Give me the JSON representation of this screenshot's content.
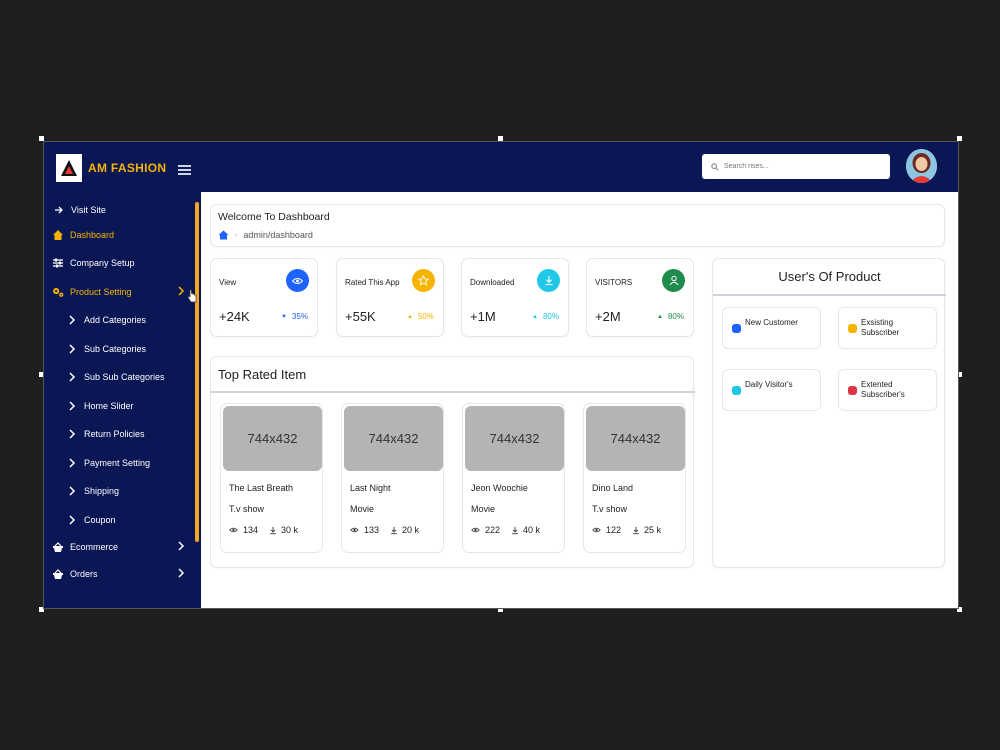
{
  "header": {
    "brand": "AM FASHION",
    "search_placeholder": "Search rises..."
  },
  "sidebar": {
    "items": [
      {
        "label": "Visit Site",
        "icon": "arrow-right-icon"
      },
      {
        "label": "Dashboard",
        "icon": "home-icon",
        "active": true
      },
      {
        "label": "Company Setup",
        "icon": "sliders-icon"
      },
      {
        "label": "Product Setting",
        "icon": "gears-icon",
        "active": true
      },
      {
        "label": "Add Categories",
        "icon": "chevron-right-icon"
      },
      {
        "label": "Sub Categories",
        "icon": "chevron-right-icon"
      },
      {
        "label": "Sub Sub Categories",
        "icon": "chevron-right-icon"
      },
      {
        "label": "Home Slider",
        "icon": "chevron-right-icon"
      },
      {
        "label": "Return Policies",
        "icon": "chevron-right-icon"
      },
      {
        "label": "Payment Setting",
        "icon": "chevron-right-icon"
      },
      {
        "label": "Shipping",
        "icon": "chevron-right-icon"
      },
      {
        "label": "Coupon",
        "icon": "chevron-right-icon"
      },
      {
        "label": "Ecommerce",
        "icon": "basket-icon"
      },
      {
        "label": "Orders",
        "icon": "basket-icon"
      }
    ]
  },
  "welcome": {
    "title": "Welcome To Dashboard",
    "breadcrumb": "admin/dashboard"
  },
  "stats": [
    {
      "title": "View",
      "value": "+24K",
      "change": "35%",
      "direction": "down",
      "color": "#1e63ff",
      "icon": "eye-icon"
    },
    {
      "title": "Rated This App",
      "value": "+55K",
      "change": "50%",
      "direction": "up",
      "color": "#f5b400",
      "icon": "star-icon"
    },
    {
      "title": "Downloaded",
      "value": "+1M",
      "change": "80%",
      "direction": "up",
      "color": "#1ec8e6",
      "icon": "download-icon"
    },
    {
      "title": "VISITORS",
      "value": "+2M",
      "change": "80%",
      "direction": "up",
      "color": "#1f8b4c",
      "icon": "user-icon"
    }
  ],
  "top_rated": {
    "title": "Top Rated Item",
    "items": [
      {
        "thumb": "744x432",
        "title": "The Last Breath",
        "type": "T.v show",
        "views": "134",
        "downloads": "30 k"
      },
      {
        "thumb": "744x432",
        "title": "Last Night",
        "type": "Movie",
        "views": "133",
        "downloads": "20 k"
      },
      {
        "thumb": "744x432",
        "title": "Jeon Woochie",
        "type": "Movie",
        "views": "222",
        "downloads": "40 k"
      },
      {
        "thumb": "744x432",
        "title": "Dino Land",
        "type": "T.v show",
        "views": "122",
        "downloads": "25 k"
      }
    ]
  },
  "users_of_product": {
    "title": "User's Of Product",
    "legend": [
      {
        "label": "New Customer",
        "color": "#1e63ff"
      },
      {
        "label": "Exsisting Subscriber",
        "color": "#f5b400"
      },
      {
        "label": "Daily Visitor's",
        "color": "#1ec8e6"
      },
      {
        "label": "Extented Subscriber's",
        "color": "#dc3545"
      }
    ]
  }
}
